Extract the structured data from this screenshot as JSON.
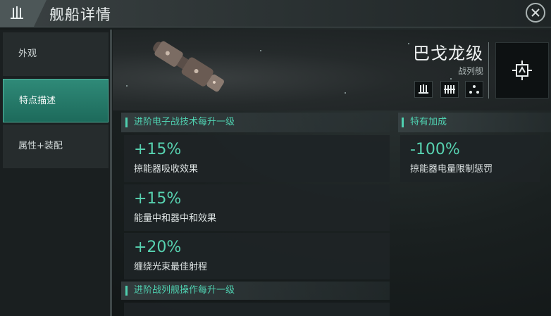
{
  "window": {
    "title": "舰船详情",
    "close_icon": "close-icon",
    "title_icon": "battleship-class-icon"
  },
  "sidebar": {
    "items": [
      {
        "label": "外观",
        "active": false
      },
      {
        "label": "特点描述",
        "active": true
      },
      {
        "label": "属性+装配",
        "active": false
      }
    ]
  },
  "ship": {
    "name": "巴戈龙级",
    "class_label": "战列舰",
    "badges": [
      "battleship-class-icon",
      "faction-icon",
      "role-icon"
    ]
  },
  "sections": {
    "skill_bonus": {
      "header": "进阶电子战技术每升一级",
      "bonuses": [
        {
          "value": "+15%",
          "desc": "掠能器吸收效果"
        },
        {
          "value": "+15%",
          "desc": "能量中和器中和效果"
        },
        {
          "value": "+20%",
          "desc": "缠绕光束最佳射程"
        }
      ]
    },
    "special_bonus": {
      "header": "特有加成",
      "bonuses": [
        {
          "value": "-100%",
          "desc": "掠能器电量限制惩罚"
        }
      ]
    },
    "skill_bonus_2": {
      "header": "进阶战列舰操作每升一级"
    }
  },
  "colors": {
    "accent": "#4fd0b0",
    "active_tab": "#2f8a78",
    "title_bar": "#3a4142"
  }
}
